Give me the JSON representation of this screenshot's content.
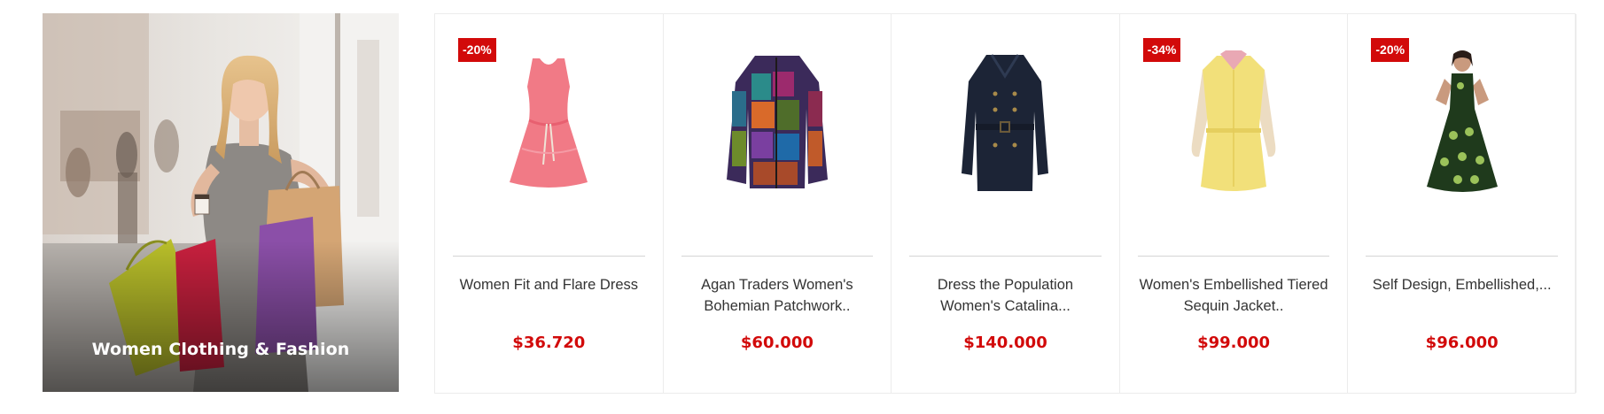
{
  "banner": {
    "title": "Women Clothing & Fashion",
    "image": "woman-with-shopping-bags"
  },
  "colors": {
    "accent": "#d20a0a",
    "text": "#333333",
    "border": "#ececec"
  },
  "products": [
    {
      "name": "Women Fit and Flare Dress",
      "price": "$36.720",
      "badge": "-20%",
      "image": "pink-dress"
    },
    {
      "name": "Agan Traders Women's Bohemian Patchwork..",
      "price": "$60.000",
      "badge": "",
      "image": "patchwork-jacket"
    },
    {
      "name": "Dress the Population Women's Catalina...",
      "price": "$140.000",
      "badge": "",
      "image": "navy-trench-coat"
    },
    {
      "name": "Women's Embellished Tiered Sequin Jacket..",
      "price": "$99.000",
      "badge": "-34%",
      "image": "yellow-shirt-dress"
    },
    {
      "name": "Self Design, Embellished,...",
      "price": "$96.000",
      "badge": "-20%",
      "image": "green-gown-model"
    }
  ]
}
